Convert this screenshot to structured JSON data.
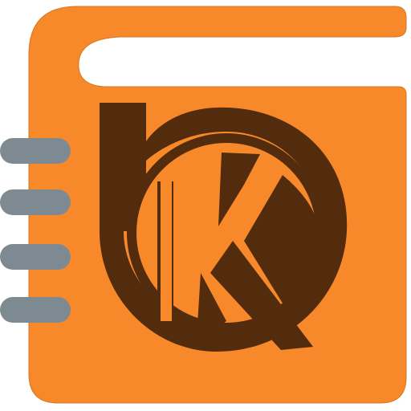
{
  "icon": {
    "name": "address-book-app-icon",
    "logo_lettering": "bK",
    "colors": {
      "cover": "#F7892B",
      "page_curl": "#FFFFFF",
      "monogram": "#532B0D",
      "spiral_rings": "#7E8A91",
      "background": "#FFFFFF"
    }
  }
}
